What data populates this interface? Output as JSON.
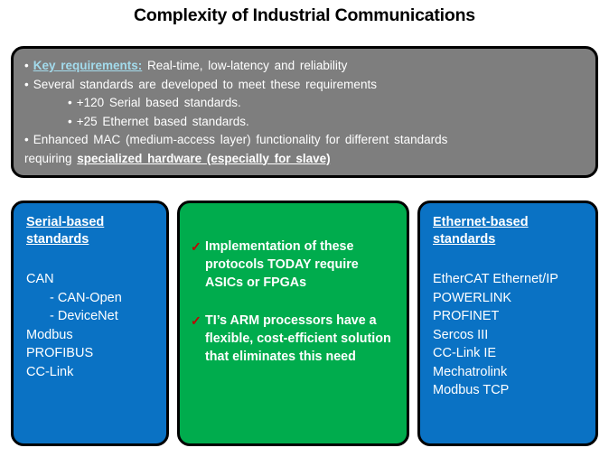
{
  "slide": {
    "title": "Complexity of Industrial Communications"
  },
  "colors": {
    "panel_blue": "#0a72c4",
    "panel_green": "#00ac4d",
    "gray_panel": "#7e7e7e",
    "key_requirements_text": "#a3dbec",
    "check_mark": "#c00000",
    "border": "#000000",
    "text_white": "#ffffff",
    "title_text": "#000000"
  },
  "gray_panel": {
    "line1": {
      "emphasis": "Key requirements:",
      "rest": "Real-time, low-latency and reliability"
    },
    "line2": "Several standards are developed to meet these requirements",
    "sub1": "+120 Serial based standards.",
    "sub2": "+25 Ethernet based standards.",
    "line3": "Enhanced MAC (medium-access layer) functionality for different standards",
    "line4_prefix": "requiring ",
    "line4_emphasis": "specialized hardware (especially for slave)"
  },
  "serial_panel": {
    "heading": "Serial-based standards",
    "items": [
      {
        "label": "CAN",
        "indent": false
      },
      {
        "label": "- CAN-Open",
        "indent": true
      },
      {
        "label": "- DeviceNet",
        "indent": true
      },
      {
        "label": "Modbus",
        "indent": false
      },
      {
        "label": "PROFIBUS",
        "indent": false
      },
      {
        "label": "CC-Link",
        "indent": false
      }
    ]
  },
  "middle_panel": {
    "check_glyph": "✓",
    "items": [
      "Implementation of these protocols TODAY require ASICs or FPGAs",
      "TI’s ARM processors have a flexible, cost-efficient solution that eliminates this need"
    ]
  },
  "ethernet_panel": {
    "heading": "Ethernet-based standards",
    "items": [
      {
        "label": "EtherCAT Ethernet/IP",
        "indent": false
      },
      {
        "label": "POWERLINK",
        "indent": false
      },
      {
        "label": "PROFINET",
        "indent": false
      },
      {
        "label": "Sercos III",
        "indent": false
      },
      {
        "label": "CC-Link IE",
        "indent": false
      },
      {
        "label": "Mechatrolink",
        "indent": false
      },
      {
        "label": "Modbus TCP",
        "indent": false
      }
    ]
  }
}
